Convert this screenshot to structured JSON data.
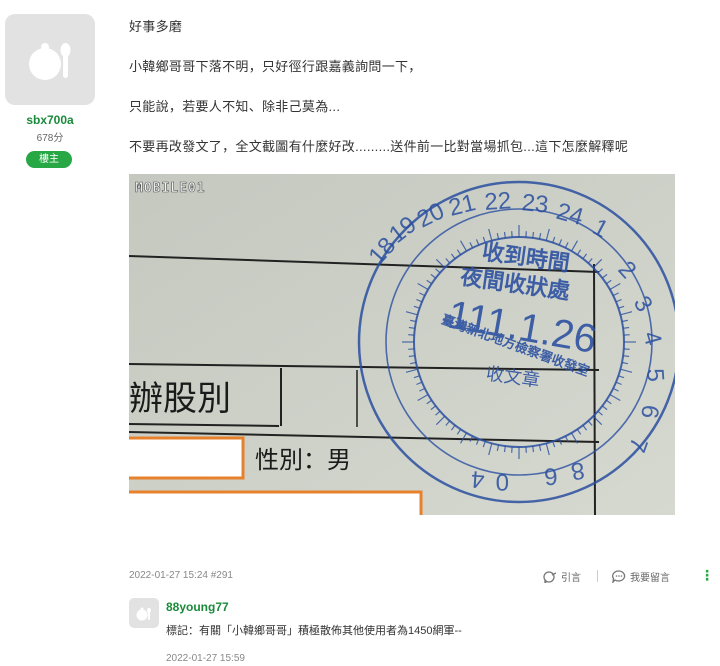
{
  "user": {
    "name": "sbx700a",
    "points": "678分",
    "badge": "樓主"
  },
  "post": {
    "lines": [
      "好事多磨",
      "小韓鄉哥哥下落不明，只好徑行跟嘉義詢問一下，",
      "只能說，若要人不知、除非己莫為...",
      "不要再改發文了，全文截圖有什麼好改.........送件前一比對當場抓包...這下怎麼解釋呢"
    ],
    "image": {
      "watermark": "MOBILE01",
      "form_text_1": "辦股別",
      "form_text_2": "性別：男",
      "stamp_line_1": "收到時間",
      "stamp_line_2": "夜間收狀處",
      "stamp_date": "111.1.26",
      "stamp_line_3": "收文章",
      "stamp_org": "臺灣新北地方檢察署收發室",
      "dial_numbers": [
        "18",
        "19",
        "20",
        "21",
        "22",
        "23",
        "24",
        "1",
        "2",
        "3",
        "4",
        "5",
        "6",
        "7",
        "8",
        "6",
        "0",
        "4"
      ]
    },
    "timestamp": "2022-01-27 15:24 #291",
    "reply_label": "引言",
    "comment_label": "我要留言",
    "more_icon": "⋮"
  },
  "comment": {
    "user": "88young77",
    "text": "標記：有關「小韓鄉哥哥」積極散佈其他使用者為1450網軍--",
    "time": "2022-01-27 15:59"
  },
  "colors": {
    "green": "#1a8a3a",
    "badge": "#28a745",
    "stamp": "#2a4fa0",
    "orange": "#e8812c"
  }
}
